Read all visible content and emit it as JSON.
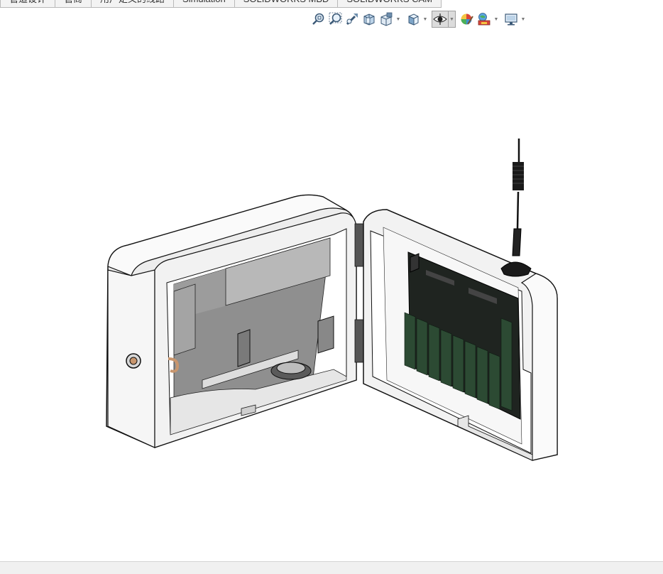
{
  "tabs": [
    {
      "label": "管道设计"
    },
    {
      "label": "管筒"
    },
    {
      "label": "用户定义的线路"
    },
    {
      "label": "Simulation"
    },
    {
      "label": "SOLIDWORKS MBD"
    },
    {
      "label": "SOLIDWORKS CAM"
    }
  ],
  "toolbar": {
    "icons": [
      "zoom-to-fit-icon",
      "zoom-to-area-icon",
      "previous-view-icon",
      "section-view-icon",
      "dynamic-annotation-view-icon",
      "view-orientation-icon",
      "display-style-icon",
      "hide-show-items-icon",
      "edit-appearance-icon",
      "apply-scene-icon",
      "view-settings-icon"
    ],
    "active": "hide-show-items-icon"
  },
  "colors": {
    "tab_bg": "#f3f3f3",
    "tab_border": "#b9b9b9",
    "model_housing": "#f4f4f4",
    "model_interior": "#8a8a8a",
    "pcb": "#1f2420",
    "terminal": "#2c4a33"
  }
}
